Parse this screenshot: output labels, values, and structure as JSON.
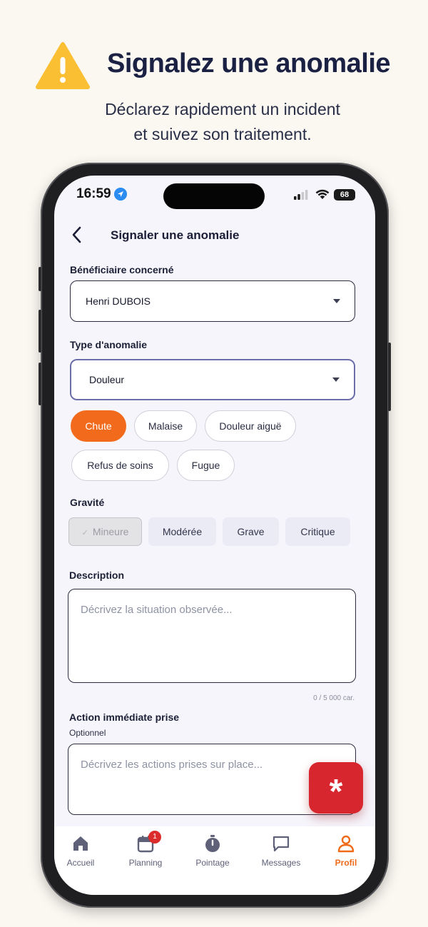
{
  "promo": {
    "title": "Signalez une anomalie",
    "subtitle_line1": "Déclarez rapidement un incident",
    "subtitle_line2": "et suivez son traitement."
  },
  "status_bar": {
    "time": "16:59",
    "battery": "68"
  },
  "header": {
    "title": "Signaler une anomalie"
  },
  "form": {
    "beneficiary": {
      "label": "Bénéficiaire concerné",
      "value": "Henri DUBOIS"
    },
    "anomaly_type": {
      "label": "Type d'anomalie",
      "value": "Douleur",
      "chips": [
        "Chute",
        "Malaise",
        "Douleur aiguë",
        "Refus de soins",
        "Fugue"
      ]
    },
    "severity": {
      "label": "Gravité",
      "options": [
        "Mineure",
        "Modérée",
        "Grave",
        "Critique"
      ],
      "selected": "Mineure"
    },
    "description": {
      "label": "Description",
      "placeholder": "Décrivez la situation observée...",
      "counter": "0 / 5 000 car."
    },
    "action": {
      "label": "Action immédiate prise",
      "sublabel": "Optionnel",
      "placeholder": "Décrivez les actions prises sur place..."
    }
  },
  "fab": {
    "symbol": "*"
  },
  "tabbar": {
    "items": [
      {
        "label": "Accueil",
        "icon": "home-icon"
      },
      {
        "label": "Planning",
        "icon": "calendar-icon",
        "badge": "1"
      },
      {
        "label": "Pointage",
        "icon": "stopwatch-icon"
      },
      {
        "label": "Messages",
        "icon": "chat-icon"
      },
      {
        "label": "Profil",
        "icon": "user-icon",
        "active": true
      }
    ]
  },
  "colors": {
    "accent": "#f26a1b",
    "danger": "#d8262e",
    "background": "#fbf7f1",
    "navy": "#1a2142"
  }
}
